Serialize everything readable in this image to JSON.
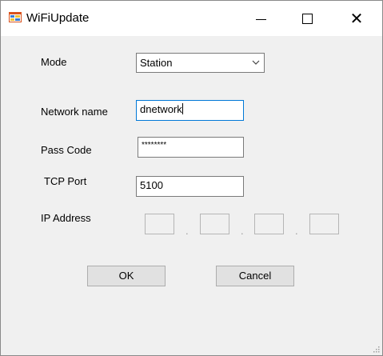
{
  "window": {
    "title": "WiFiUpdate",
    "app_icon": "windows-form-icon",
    "controls": [
      "minimize-icon",
      "maximize-icon",
      "close-icon"
    ]
  },
  "form": {
    "mode_label": "Mode",
    "mode_value": "Station",
    "network_label": "Network name",
    "network_value": "dnetwork",
    "passcode_label": "Pass Code",
    "passcode_value": "********",
    "tcp_port_label": "TCP Port",
    "tcp_port_value": "5100",
    "ip_label": "IP Address",
    "ip_separator": ".",
    "ip_octets": [
      "",
      "",
      "",
      ""
    ]
  },
  "buttons": {
    "ok_label": "OK",
    "cancel_label": "Cancel"
  },
  "colors": {
    "window_bg": "#f0f0f0",
    "titlebar_bg": "#ffffff",
    "focus_border": "#0078d7",
    "button_bg": "#e1e1e1"
  }
}
